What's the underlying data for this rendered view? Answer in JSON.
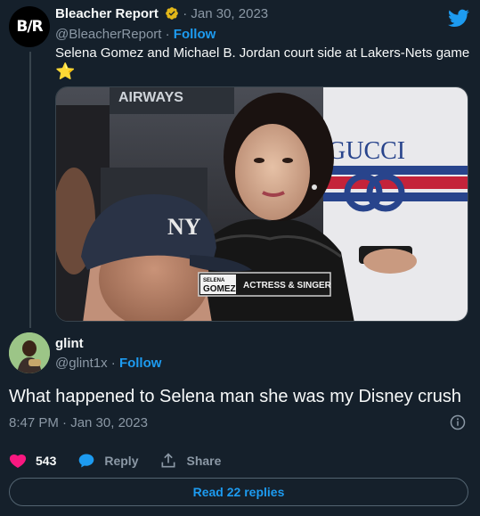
{
  "tweet": {
    "avatar_text": "B/R",
    "author": "Bleacher Report",
    "date_sep": "·",
    "date": "Jan 30, 2023",
    "handle": "@BleacherReport",
    "follow_sep": "·",
    "follow_label": "Follow",
    "text": "Selena Gomez and Michael B. Jordan court side at Lakers-Nets game",
    "emoji": "⭐",
    "media": {
      "sign_text": "AIRWAYS",
      "jersey_text": "GUCCI",
      "cap_text": "NY",
      "lowerthird_name_top": "SELENA",
      "lowerthird_name_bottom": "GOMEZ",
      "lowerthird_title": "ACTRESS & SINGER"
    }
  },
  "reply": {
    "author": "glint",
    "handle": "@glint1x",
    "follow_sep": "·",
    "follow_label": "Follow",
    "text": "What happened to Selena man she was my Disney crush",
    "timestamp": "8:47 PM · Jan 30, 2023"
  },
  "actions": {
    "like_count": "543",
    "reply_label": "Reply",
    "share_label": "Share"
  },
  "read_replies_label": "Read 22 replies",
  "colors": {
    "background": "#15202b",
    "accent": "#1d9bf0",
    "like": "#f91880",
    "muted": "#8b98a5"
  }
}
